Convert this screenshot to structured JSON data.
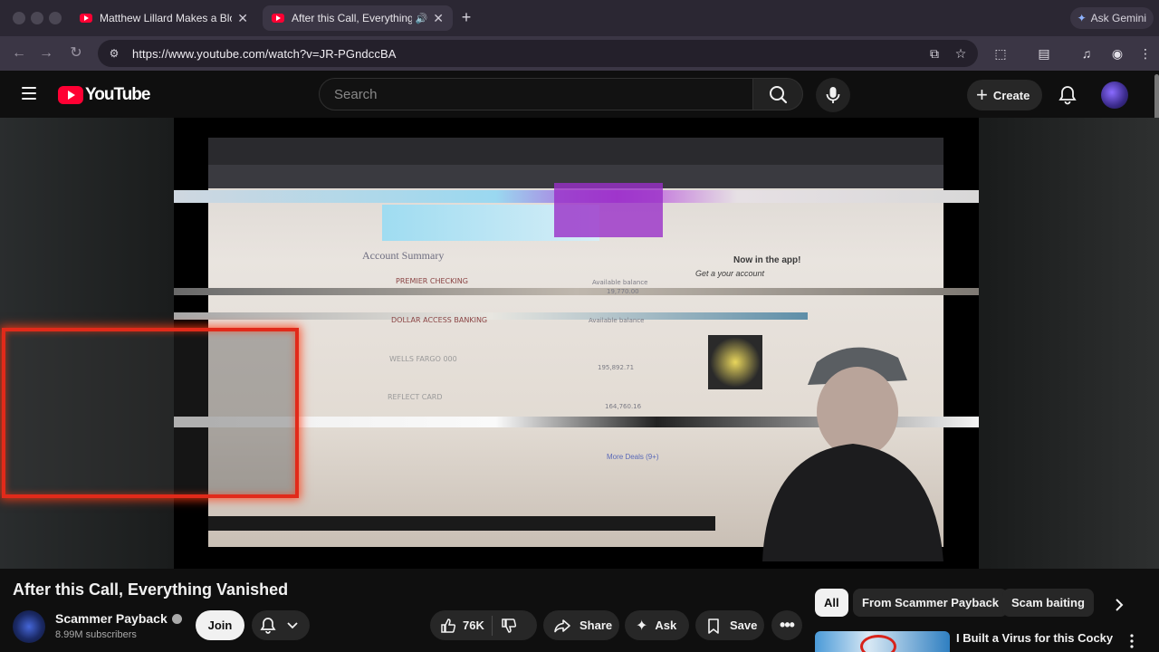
{
  "browser": {
    "tabs": [
      {
        "title": "Matthew Lillard Makes a Bloo",
        "active": false
      },
      {
        "title": "After this Call, Everything",
        "active": true
      }
    ],
    "gemini_label": "Ask Gemini",
    "url": "https://www.youtube.com/watch?v=JR-PGndccBA"
  },
  "youtube": {
    "logo_text": "YouTube",
    "search_placeholder": "Search",
    "create_label": "Create"
  },
  "video_frame": {
    "account_summary": "Account Summary",
    "rows": [
      "PREMIER CHECKING",
      "DOLLAR ACCESS BANKING",
      "WELLS FARGO 000",
      "REFLECT CARD"
    ],
    "available_balance": "Available balance",
    "balances": [
      "19,770.00",
      "195,892.71",
      "164,760.16"
    ],
    "promo_title": "Now in the app!",
    "promo_sub": "Get a your account",
    "more_deals": "More Deals (9+)"
  },
  "video": {
    "title": "After this Call, Everything Vanished",
    "channel": "Scammer Payback",
    "subscribers": "8.99M subscribers",
    "join_label": "Join",
    "like_count": "76K",
    "share_label": "Share",
    "ask_label": "Ask",
    "save_label": "Save"
  },
  "sidebar": {
    "chips": [
      "All",
      "From Scammer Payback",
      "Scam baiting"
    ],
    "recommended": [
      {
        "title": "I Built a Virus for this Cocky"
      }
    ]
  },
  "colors": {
    "youtube_red": "#ff0033",
    "highlight_red": "#e12a1a",
    "background": "#0f0f0f"
  }
}
